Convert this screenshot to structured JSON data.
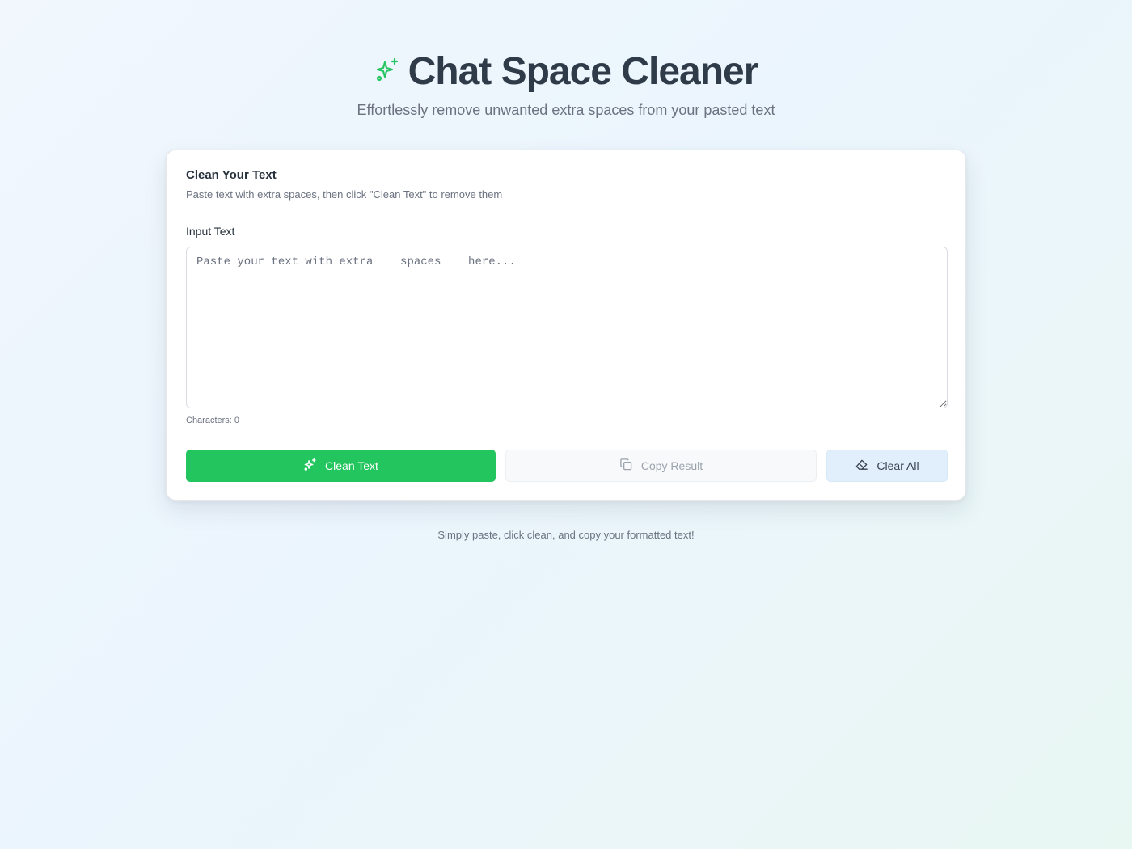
{
  "header": {
    "title": "Chat Space Cleaner",
    "subtitle": "Effortlessly remove unwanted extra spaces from your pasted text",
    "icon": "sparkles-icon",
    "accent_color": "#22c55e"
  },
  "card": {
    "title": "Clean Your Text",
    "description": "Paste text with extra spaces, then click \"Clean Text\" to remove them",
    "input_label": "Input Text",
    "input_value": "",
    "input_placeholder": "Paste your text with extra    spaces    here...",
    "char_count_label": "Characters: ",
    "char_count_value": "0"
  },
  "actions": {
    "clean_label": "Clean Text",
    "clean_icon": "sparkles-icon",
    "clean_color": "#22c55e",
    "copy_label": "Copy Result",
    "copy_icon": "copy-icon",
    "copy_disabled": true,
    "clear_label": "Clear All",
    "clear_icon": "eraser-icon"
  },
  "footer": {
    "text": "Simply paste, click clean, and copy your formatted text!"
  }
}
